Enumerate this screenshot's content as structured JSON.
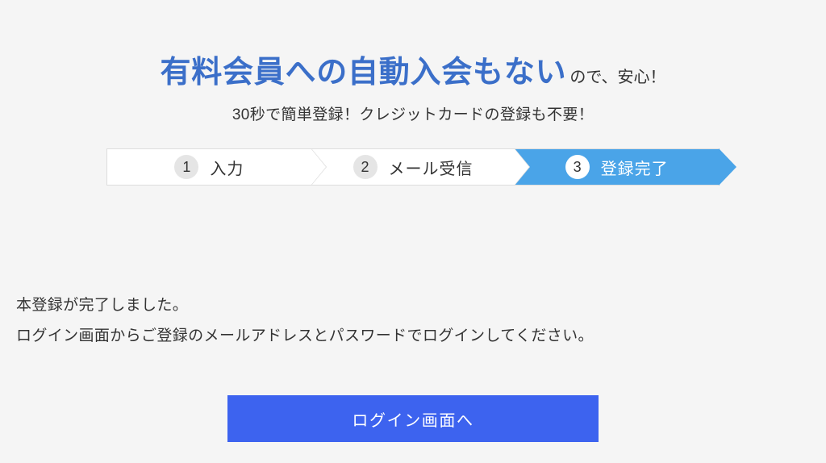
{
  "header": {
    "headline_main": "有料会員への自動入会もない",
    "headline_sub": "ので、安心！",
    "subtext": "30秒で簡単登録！クレジットカードの登録も不要！"
  },
  "stepper": {
    "steps": [
      {
        "num": "1",
        "label": "入力"
      },
      {
        "num": "2",
        "label": "メール受信"
      },
      {
        "num": "3",
        "label": "登録完了"
      }
    ]
  },
  "message": {
    "line1": "本登録が完了しました。",
    "line2": "ログイン画面からご登録のメールアドレスとパスワードでログインしてください。"
  },
  "actions": {
    "login_button_label": "ログイン画面へ"
  }
}
